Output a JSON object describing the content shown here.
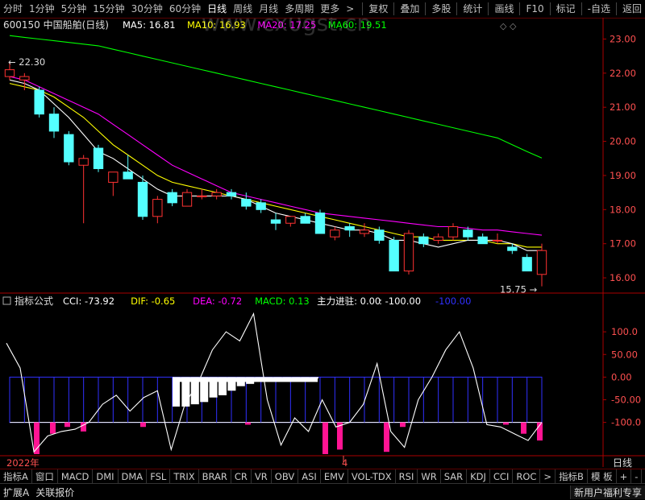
{
  "toolbar": {
    "periods": [
      "分时",
      "1分钟",
      "5分钟",
      "15分钟",
      "30分钟",
      "60分钟",
      "日线",
      "周线",
      "月线",
      "多周期",
      "更多"
    ],
    "active_period": "日线",
    "more_arrow": ">",
    "right_buttons": [
      "复权",
      "叠加",
      "多股",
      "统计",
      "画线",
      "F10",
      "标记",
      "-自选",
      "返回"
    ]
  },
  "stock": {
    "code_name": "600150 中国船舶(日线)",
    "watermark": "www.cx0gst.cn"
  },
  "ma_legend": [
    {
      "label": "MA5: 16.81",
      "color": "#ffffff"
    },
    {
      "label": "MA10: 16.93",
      "color": "#ffff00"
    },
    {
      "label": "MA20: 17.25",
      "color": "#ff00ff"
    },
    {
      "label": "MA60: 19.51",
      "color": "#00ff00"
    }
  ],
  "colors": {
    "up": "#ff3232",
    "down": "#54ffff",
    "ma5": "#ffffff",
    "ma10": "#ffff00",
    "ma20": "#ff00ff",
    "ma60": "#00ff00",
    "axis": "#aa0000",
    "pink": "#ff1493",
    "blue": "#3030ff"
  },
  "chart_data": [
    {
      "type": "candlestick",
      "ylim": [
        15.6,
        23.2
      ],
      "y_ticks": [
        "23.00",
        "22.00",
        "21.00",
        "20.00",
        "19.00",
        "18.00",
        "17.00",
        "16.00"
      ],
      "high_annotation": "22.30",
      "low_annotation": "15.75",
      "candles": [
        {
          "o": 21.9,
          "h": 22.3,
          "l": 21.8,
          "c": 22.1
        },
        {
          "o": 21.8,
          "h": 22.0,
          "l": 21.5,
          "c": 21.9
        },
        {
          "o": 21.5,
          "h": 21.6,
          "l": 20.7,
          "c": 20.8
        },
        {
          "o": 20.8,
          "h": 21.0,
          "l": 20.1,
          "c": 20.3
        },
        {
          "o": 20.2,
          "h": 20.3,
          "l": 19.3,
          "c": 19.4
        },
        {
          "o": 19.3,
          "h": 19.6,
          "l": 17.6,
          "c": 19.5
        },
        {
          "o": 19.8,
          "h": 19.9,
          "l": 19.1,
          "c": 19.2
        },
        {
          "o": 18.8,
          "h": 19.0,
          "l": 18.4,
          "c": 19.1
        },
        {
          "o": 19.1,
          "h": 19.6,
          "l": 18.9,
          "c": 18.9
        },
        {
          "o": 18.8,
          "h": 19.0,
          "l": 17.7,
          "c": 17.8
        },
        {
          "o": 17.8,
          "h": 18.4,
          "l": 17.6,
          "c": 18.3
        },
        {
          "o": 18.5,
          "h": 18.6,
          "l": 18.1,
          "c": 18.2
        },
        {
          "o": 18.1,
          "h": 18.6,
          "l": 18.1,
          "c": 18.5
        },
        {
          "o": 18.4,
          "h": 18.6,
          "l": 18.3,
          "c": 18.4
        },
        {
          "o": 18.4,
          "h": 18.6,
          "l": 18.3,
          "c": 18.5
        },
        {
          "o": 18.5,
          "h": 18.6,
          "l": 18.3,
          "c": 18.4
        },
        {
          "o": 18.3,
          "h": 18.5,
          "l": 18.0,
          "c": 18.1
        },
        {
          "o": 18.2,
          "h": 18.3,
          "l": 17.9,
          "c": 18.0
        },
        {
          "o": 17.7,
          "h": 17.9,
          "l": 17.4,
          "c": 17.6
        },
        {
          "o": 17.6,
          "h": 17.8,
          "l": 17.5,
          "c": 17.8
        },
        {
          "o": 17.8,
          "h": 17.9,
          "l": 17.6,
          "c": 17.6
        },
        {
          "o": 17.9,
          "h": 18.0,
          "l": 17.3,
          "c": 17.3
        },
        {
          "o": 17.2,
          "h": 17.5,
          "l": 17.1,
          "c": 17.4
        },
        {
          "o": 17.5,
          "h": 17.6,
          "l": 17.2,
          "c": 17.4
        },
        {
          "o": 17.3,
          "h": 17.6,
          "l": 17.2,
          "c": 17.4
        },
        {
          "o": 17.4,
          "h": 17.5,
          "l": 17.0,
          "c": 17.1
        },
        {
          "o": 17.1,
          "h": 17.2,
          "l": 16.2,
          "c": 16.2
        },
        {
          "o": 16.2,
          "h": 17.4,
          "l": 16.1,
          "c": 17.3
        },
        {
          "o": 17.2,
          "h": 17.3,
          "l": 16.9,
          "c": 17.0
        },
        {
          "o": 17.1,
          "h": 17.3,
          "l": 17.0,
          "c": 17.2
        },
        {
          "o": 17.2,
          "h": 17.6,
          "l": 17.1,
          "c": 17.5
        },
        {
          "o": 17.4,
          "h": 17.5,
          "l": 17.1,
          "c": 17.2
        },
        {
          "o": 17.2,
          "h": 17.3,
          "l": 17.0,
          "c": 17.0
        },
        {
          "o": 17.1,
          "h": 17.3,
          "l": 17.0,
          "c": 17.1
        },
        {
          "o": 16.9,
          "h": 17.0,
          "l": 16.7,
          "c": 16.8
        },
        {
          "o": 16.6,
          "h": 16.7,
          "l": 16.2,
          "c": 16.2
        },
        {
          "o": 16.1,
          "h": 17.0,
          "l": 15.75,
          "c": 16.8
        }
      ],
      "ma5": [
        21.8,
        21.7,
        21.5,
        21.1,
        20.7,
        20.2,
        19.7,
        19.5,
        19.2,
        18.9,
        18.6,
        18.4,
        18.4,
        18.4,
        18.4,
        18.4,
        18.3,
        18.1,
        17.9,
        17.8,
        17.7,
        17.6,
        17.5,
        17.4,
        17.4,
        17.3,
        17.1,
        17.1,
        17.0,
        16.9,
        17.0,
        17.1,
        17.1,
        17.1,
        17.0,
        16.8,
        16.8
      ],
      "ma10": [
        21.7,
        21.6,
        21.5,
        21.3,
        21.0,
        20.7,
        20.3,
        19.9,
        19.6,
        19.3,
        19.0,
        18.8,
        18.7,
        18.6,
        18.5,
        18.4,
        18.3,
        18.2,
        18.1,
        18.0,
        17.9,
        17.8,
        17.7,
        17.6,
        17.5,
        17.4,
        17.3,
        17.2,
        17.2,
        17.1,
        17.1,
        17.1,
        17.1,
        17.0,
        17.0,
        16.9,
        16.9
      ],
      "ma20": [
        21.9,
        21.8,
        21.6,
        21.4,
        21.2,
        21.0,
        20.8,
        20.5,
        20.2,
        19.9,
        19.6,
        19.3,
        19.1,
        18.9,
        18.7,
        18.5,
        18.4,
        18.3,
        18.2,
        18.1,
        18.0,
        17.9,
        17.85,
        17.8,
        17.75,
        17.7,
        17.65,
        17.6,
        17.55,
        17.5,
        17.5,
        17.45,
        17.4,
        17.4,
        17.35,
        17.3,
        17.25
      ],
      "ma60": [
        23.1,
        23.05,
        23.0,
        22.95,
        22.9,
        22.85,
        22.8,
        22.7,
        22.6,
        22.5,
        22.4,
        22.3,
        22.2,
        22.1,
        22.0,
        21.9,
        21.8,
        21.7,
        21.6,
        21.5,
        21.4,
        21.3,
        21.2,
        21.1,
        21.0,
        20.9,
        20.8,
        20.7,
        20.6,
        20.5,
        20.4,
        20.3,
        20.2,
        20.1,
        19.9,
        19.7,
        19.51
      ]
    },
    {
      "type": "indicator",
      "title": "指标公式",
      "legend": [
        {
          "label": "CCI: -73.92",
          "color": "#ffffff"
        },
        {
          "label": "DIF: -0.65",
          "color": "#ffff00"
        },
        {
          "label": "DEA: -0.72",
          "color": "#ff00ff"
        },
        {
          "label": "MACD: 0.13",
          "color": "#00ff00"
        },
        {
          "label": "主力进驻: 0.00",
          "color": "#ffffff"
        },
        {
          "label": ": -100.00",
          "color": "#ffffff"
        },
        {
          "label": "-100.00",
          "color": "#3030ff"
        }
      ],
      "ylim": [
        -170,
        150
      ],
      "y_ticks": [
        "100.0",
        "50.00",
        "0.00",
        "-50.00",
        "-100.0"
      ],
      "cci": [
        75,
        20,
        -165,
        -130,
        -120,
        -115,
        -100,
        -60,
        -40,
        -75,
        -45,
        -30,
        -160,
        -60,
        -10,
        60,
        100,
        80,
        140,
        -50,
        -150,
        -90,
        -120,
        -50,
        -110,
        -100,
        -60,
        30,
        -120,
        -155,
        -50,
        0,
        60,
        100,
        20,
        -105,
        -110,
        -125,
        -140,
        -100
      ],
      "pink_bars": [
        -170,
        -125,
        -110,
        -120,
        -110,
        -105,
        -100,
        -170,
        -160,
        -165,
        -110,
        -105,
        -125,
        -140,
        -175,
        -105,
        -115,
        -135,
        -145
      ],
      "pink_bar_idx": [
        1,
        2,
        3,
        4,
        5,
        6,
        7,
        9,
        10,
        11,
        12,
        13,
        14,
        15,
        16,
        17,
        18,
        19,
        20
      ],
      "white_bars": [
        {
          "v": -65
        },
        {
          "v": -65
        },
        {
          "v": -60
        },
        {
          "v": -55
        },
        {
          "v": -45
        },
        {
          "v": -40
        },
        {
          "v": -30
        },
        {
          "v": -20
        },
        {
          "v": -15
        },
        {
          "v": -10
        },
        {
          "v": -8
        },
        {
          "v": -7
        },
        {
          "v": -6
        },
        {
          "v": -5
        },
        {
          "v": -4
        },
        {
          "v": -3
        }
      ]
    }
  ],
  "time_axis": {
    "labels": [
      "2022年",
      "4"
    ]
  },
  "period_label": "日线",
  "indicator_tabs": [
    "指标A",
    "窗口",
    "MACD",
    "DMI",
    "DMA",
    "FSL",
    "TRIX",
    "BRAR",
    "CR",
    "VR",
    "OBV",
    "ASI",
    "EMV",
    "VOL-TDX",
    "RSI",
    "WR",
    "SAR",
    "KDJ",
    "CCI",
    "ROC",
    ">",
    "指标B",
    "模 板",
    "+",
    "-"
  ],
  "bottom_bar": {
    "left": [
      "扩展A",
      "关联报价"
    ],
    "right": "新用户福利专享"
  },
  "corner_icons": "◇ ◇"
}
